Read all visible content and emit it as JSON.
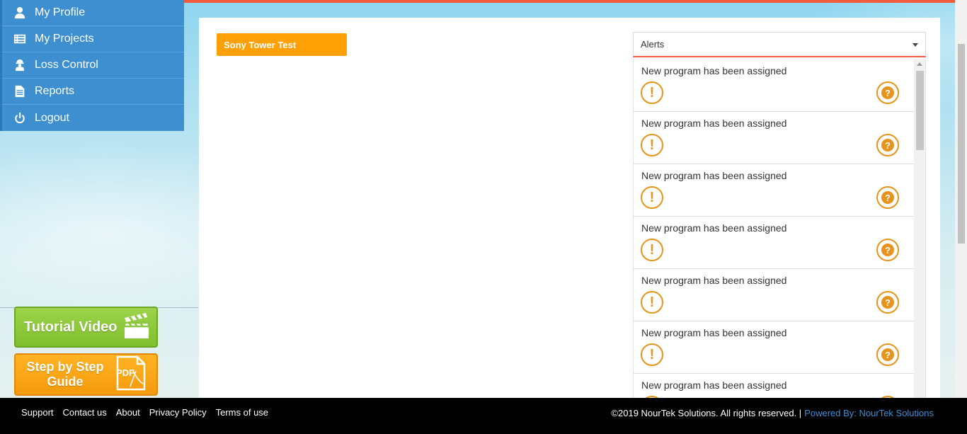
{
  "sidebar": {
    "items": [
      {
        "label": "My Profile",
        "icon": "user-icon"
      },
      {
        "label": "My Projects",
        "icon": "list-icon"
      },
      {
        "label": "Loss Control",
        "icon": "worker-icon"
      },
      {
        "label": "Reports",
        "icon": "document-icon"
      },
      {
        "label": "Logout",
        "icon": "power-icon"
      }
    ]
  },
  "promos": {
    "video_label": "Tutorial Video",
    "guide_label_line1": "Step by Step",
    "guide_label_line2": "Guide",
    "pdf_text": "PDF"
  },
  "main": {
    "project_name": "Sony Tower Test",
    "alerts_select": {
      "selected": "Alerts"
    },
    "alerts": [
      {
        "text": "New program has been assigned"
      },
      {
        "text": "New program has been assigned"
      },
      {
        "text": "New program has been assigned"
      },
      {
        "text": "New program has been assigned"
      },
      {
        "text": "New program has been assigned"
      },
      {
        "text": "New program has been assigned"
      },
      {
        "text": "New program has been assigned"
      }
    ],
    "warn_glyph": "!",
    "help_glyph": "?"
  },
  "footer": {
    "links": [
      "Support",
      "Contact us",
      "About",
      "Privacy Policy",
      "Terms of use"
    ],
    "copyright": "©2019 NourTek Solutions. All rights reserved. |",
    "powered_by": "Powered By: NourTek Solutions"
  },
  "colors": {
    "sidebar_bg": "#3d8fcf",
    "accent_orange": "#ffa005",
    "alert_orange": "#e8931c",
    "top_line": "#f25c3c",
    "footer_bg": "#000000",
    "link_blue": "#3c8fd6"
  }
}
